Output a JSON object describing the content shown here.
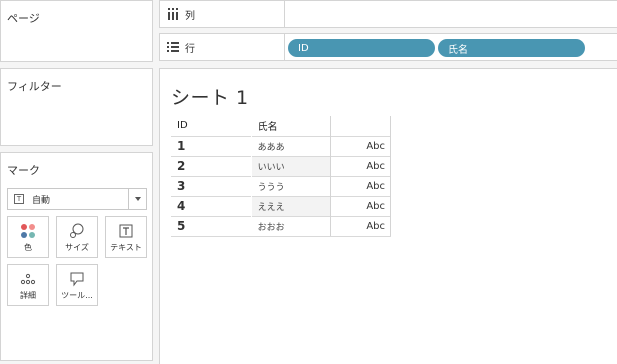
{
  "pages": {
    "title": "ページ"
  },
  "filters": {
    "title": "フィルター"
  },
  "marks": {
    "title": "マーク",
    "mark_type": "自動",
    "cards": [
      {
        "label": "色",
        "icon": "color-dots-icon"
      },
      {
        "label": "サイズ",
        "icon": "size-circles-icon"
      },
      {
        "label": "テキスト",
        "icon": "text-box-icon"
      },
      {
        "label": "詳細",
        "icon": "detail-dots-icon"
      },
      {
        "label": "ツール...",
        "icon": "tooltip-bubble-icon"
      }
    ]
  },
  "shelves": {
    "columns": {
      "label": "列",
      "icon": "columns-icon"
    },
    "rows": {
      "label": "行",
      "icon": "rows-icon",
      "pills": [
        "ID",
        "氏名"
      ]
    }
  },
  "colors": {
    "pill": "#4996b2",
    "accent_red": "#e15759",
    "accent_blue": "#4e79a7"
  },
  "sheet": {
    "title": "シート 1",
    "headers": [
      "ID",
      "氏名",
      ""
    ],
    "rows": [
      {
        "id": "1",
        "name": "あああ",
        "abc": "Abc"
      },
      {
        "id": "2",
        "name": "いいい",
        "abc": "Abc"
      },
      {
        "id": "3",
        "name": "ううう",
        "abc": "Abc"
      },
      {
        "id": "4",
        "name": "えええ",
        "abc": "Abc"
      },
      {
        "id": "5",
        "name": "おおお",
        "abc": "Abc"
      }
    ]
  }
}
